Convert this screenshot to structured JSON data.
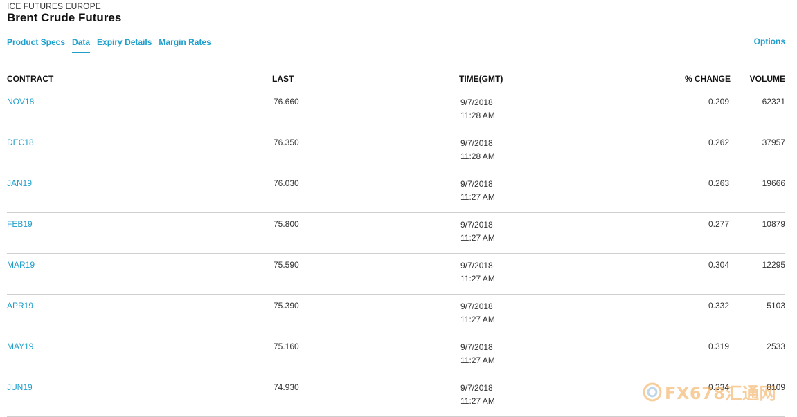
{
  "header": {
    "exchange": "ICE FUTURES EUROPE",
    "product": "Brent Crude Futures"
  },
  "tabs": [
    {
      "label": "Product Specs",
      "active": false
    },
    {
      "label": "Data",
      "active": true
    },
    {
      "label": "Expiry Details",
      "active": false
    },
    {
      "label": "Margin Rates",
      "active": false
    }
  ],
  "options_label": "Options",
  "table": {
    "columns": {
      "contract": "CONTRACT",
      "last": "LAST",
      "time": "TIME(GMT)",
      "change": "% CHANGE",
      "volume": "VOLUME"
    },
    "rows": [
      {
        "contract": "NOV18",
        "last": "76.660",
        "date": "9/7/2018",
        "time": "11:28 AM",
        "change": "0.209",
        "volume": "62321"
      },
      {
        "contract": "DEC18",
        "last": "76.350",
        "date": "9/7/2018",
        "time": "11:28 AM",
        "change": "0.262",
        "volume": "37957"
      },
      {
        "contract": "JAN19",
        "last": "76.030",
        "date": "9/7/2018",
        "time": "11:27 AM",
        "change": "0.263",
        "volume": "19666"
      },
      {
        "contract": "FEB19",
        "last": "75.800",
        "date": "9/7/2018",
        "time": "11:27 AM",
        "change": "0.277",
        "volume": "10879"
      },
      {
        "contract": "MAR19",
        "last": "75.590",
        "date": "9/7/2018",
        "time": "11:27 AM",
        "change": "0.304",
        "volume": "12295"
      },
      {
        "contract": "APR19",
        "last": "75.390",
        "date": "9/7/2018",
        "time": "11:27 AM",
        "change": "0.332",
        "volume": "5103"
      },
      {
        "contract": "MAY19",
        "last": "75.160",
        "date": "9/7/2018",
        "time": "11:27 AM",
        "change": "0.319",
        "volume": "2533"
      },
      {
        "contract": "JUN19",
        "last": "74.930",
        "date": "9/7/2018",
        "time": "11:27 AM",
        "change": "0.334",
        "volume": "8109"
      }
    ]
  },
  "watermark": {
    "text": "FX678汇通网",
    "icon": "fx678-logo-icon"
  },
  "colors": {
    "link": "#1e9fcc",
    "watermark": "#f2a54a"
  }
}
